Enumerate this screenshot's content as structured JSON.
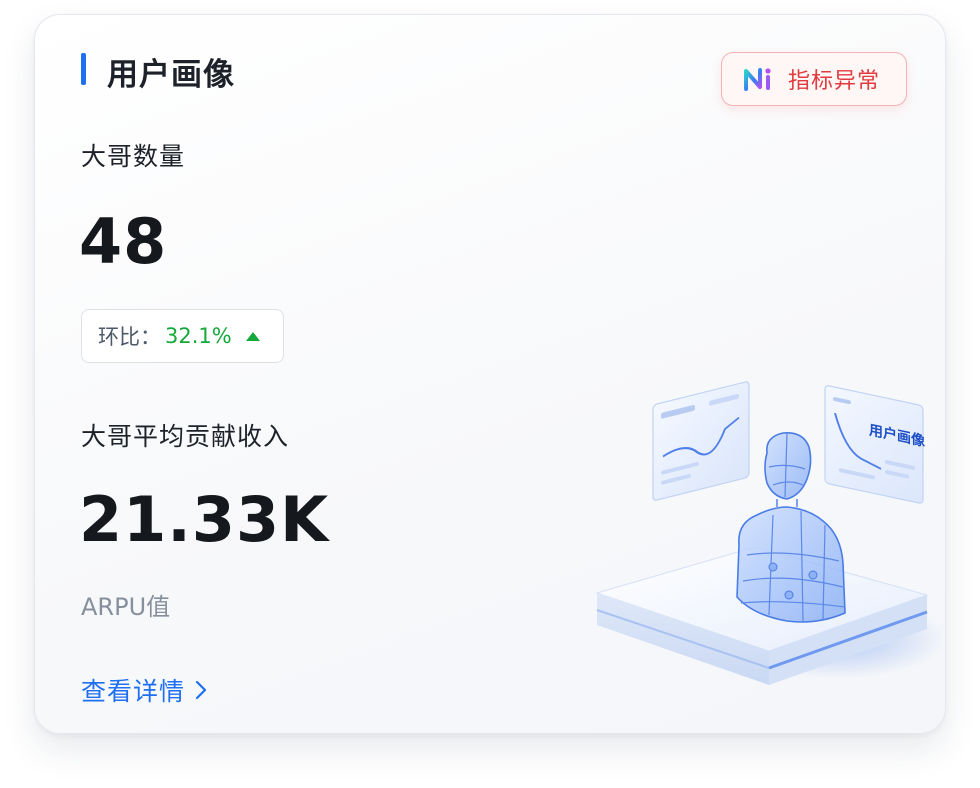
{
  "card": {
    "title": "用户画像",
    "ai_button": {
      "icon": "ai-logo-icon",
      "label": "指标异常"
    }
  },
  "metric_primary": {
    "label": "大哥数量",
    "value": "48",
    "change": {
      "label": "环比：",
      "value": "32.1%",
      "direction_icon": "triangle-up-icon"
    }
  },
  "metric_secondary": {
    "label": "大哥平均贡献收入",
    "value": "21.33K",
    "sublabel": "ARPU值"
  },
  "footer": {
    "link_label": "查看详情",
    "link_icon": "chevron-right-icon"
  },
  "illustration": {
    "icon": "user-portrait-illustration",
    "panel_title": "用户画像"
  },
  "colors": {
    "accent": "#1f6ff2",
    "alert": "#e03b3f",
    "positive": "#15a83a"
  }
}
